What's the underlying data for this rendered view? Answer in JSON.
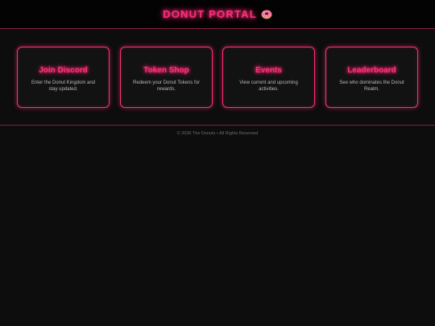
{
  "header": {
    "title": "DONUT PORTAL",
    "icon": "donut-icon"
  },
  "cards": [
    {
      "title": "Join Discord",
      "description": "Enter the Donut Kingdom and stay updated."
    },
    {
      "title": "Token Shop",
      "description": "Redeem your Donut Tokens for rewards."
    },
    {
      "title": "Events",
      "description": "View current and upcoming activities."
    },
    {
      "title": "Leaderboard",
      "description": "See who dominates the Donut Realm."
    }
  ],
  "footer": {
    "text": "© 2026 The Donuts • All Rights Reserved"
  },
  "colors": {
    "accent": "#ff2e78",
    "background": "#0d0d0d",
    "header_bg": "#030303"
  }
}
